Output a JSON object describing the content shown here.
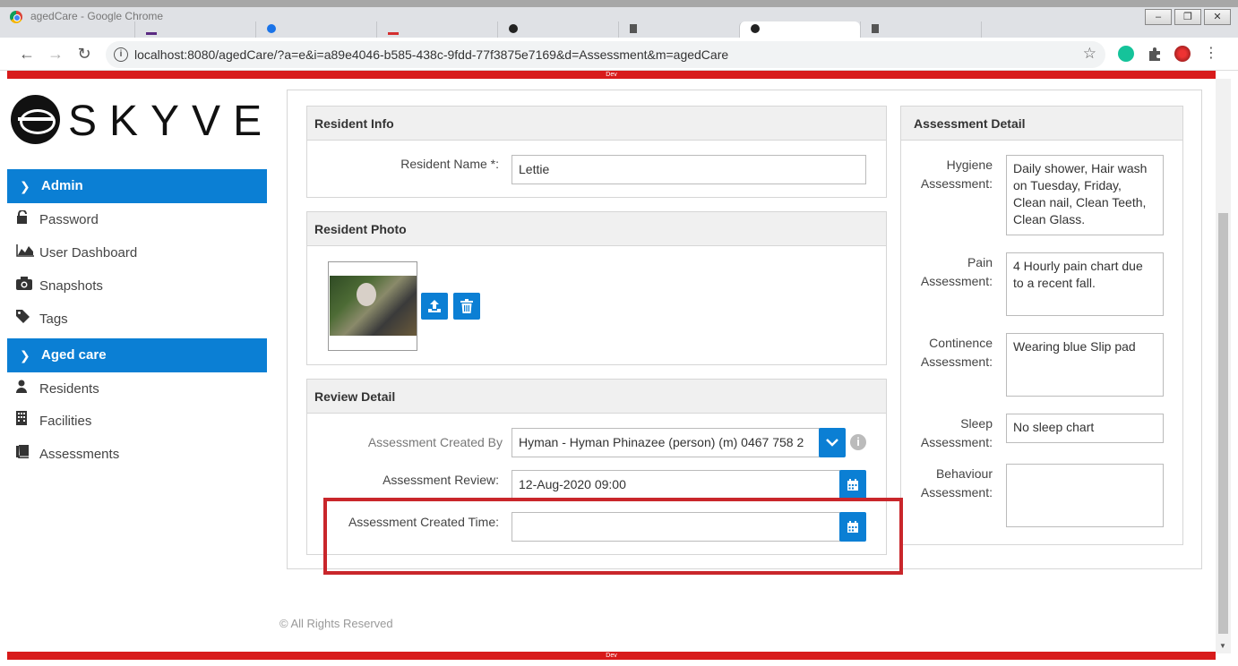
{
  "window": {
    "title": "agedCare - Google Chrome",
    "minimize": "–",
    "restore": "❐",
    "close": "✕"
  },
  "browser": {
    "url": "localhost:8080/agedCare/?a=e&i=a89e4046-b585-438c-9fdd-77f3875e7169&d=Assessment&m=agedCare",
    "back": "←",
    "forward": "→",
    "reload": "↻",
    "info": "i",
    "star": "☆",
    "env_top": "Dev",
    "env_bottom": "Dev"
  },
  "sidebar": {
    "logo_text": "SKYVE",
    "sections": [
      {
        "label": "Admin",
        "items": [
          "Password",
          "User Dashboard",
          "Snapshots",
          "Tags"
        ]
      },
      {
        "label": "Aged care",
        "items": [
          "Residents",
          "Facilities",
          "Assessments"
        ]
      }
    ]
  },
  "resident_info": {
    "title": "Resident Info",
    "name_label": "Resident Name *:",
    "name_value": "Lettie"
  },
  "resident_photo": {
    "title_a": "Resident",
    "title_b": "Photo"
  },
  "review_detail": {
    "title": "Review Detail",
    "created_by_label": "Assessment Created By",
    "created_by_value": "Hyman - Hyman Phinazee (person) (m) 0467 758 2",
    "review_label": "Assessment Review:",
    "review_value": "12-Aug-2020 09:00",
    "created_time_label": "Assessment Created Time:",
    "created_time_value": ""
  },
  "assessment_detail": {
    "title": "Assessment Detail",
    "fields": [
      {
        "label_1": "Hygiene",
        "label_2": "Assessment:",
        "value": "Daily shower, Hair wash on Tuesday, Friday, Clean nail, Clean Teeth, Clean Glass."
      },
      {
        "label_1": "Pain",
        "label_2": "Assessment:",
        "value": "4 Hourly pain chart due to a recent fall."
      },
      {
        "label_1": "Continence",
        "label_2": "Assessment:",
        "value": "Wearing blue Slip pad"
      },
      {
        "label_1": "Sleep",
        "label_2": "Assessment:",
        "value": "No sleep chart"
      },
      {
        "label_1": "Behaviour",
        "label_2": "Assessment:",
        "value": ""
      }
    ]
  },
  "footer": {
    "text": "© All Rights Reserved"
  },
  "colors": {
    "accent": "#0b7fd4",
    "env_bar": "#d81b1b",
    "highlight": "#c9262b"
  }
}
